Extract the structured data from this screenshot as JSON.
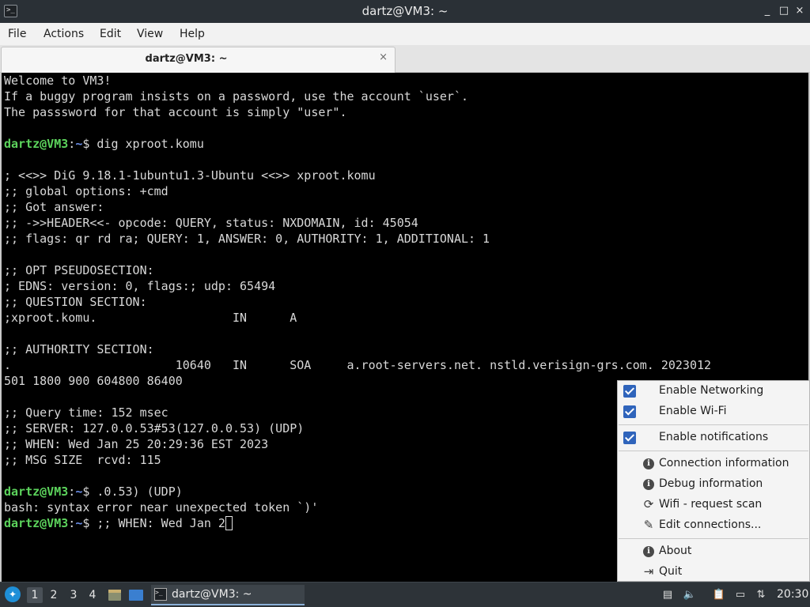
{
  "window": {
    "title": "dartz@VM3: ~",
    "app_icon": "terminal-icon",
    "controls": {
      "minimize": "_",
      "maximize": "□",
      "close": "×"
    }
  },
  "menubar": {
    "items": [
      "File",
      "Actions",
      "Edit",
      "View",
      "Help"
    ]
  },
  "tabs": [
    {
      "label": "dartz@VM3: ~",
      "close": "×"
    }
  ],
  "terminal": {
    "prompt_user": "dartz@VM3",
    "prompt_sep": ":",
    "prompt_path": "~",
    "prompt_dollar": "$",
    "lines": [
      "Welcome to VM3!",
      "If a buggy program insists on a password, use the account `user`.",
      "The passsword for that account is simply \"user\".",
      "",
      " dig xproot.komu",
      "",
      "; <<>> DiG 9.18.1-1ubuntu1.3-Ubuntu <<>> xproot.komu",
      ";; global options: +cmd",
      ";; Got answer:",
      ";; ->>HEADER<<- opcode: QUERY, status: NXDOMAIN, id: 45054",
      ";; flags: qr rd ra; QUERY: 1, ANSWER: 0, AUTHORITY: 1, ADDITIONAL: 1",
      "",
      ";; OPT PSEUDOSECTION:",
      "; EDNS: version: 0, flags:; udp: 65494",
      ";; QUESTION SECTION:",
      ";xproot.komu.                   IN      A",
      "",
      ";; AUTHORITY SECTION:",
      ".                       10640   IN      SOA     a.root-servers.net. nstld.verisign-grs.com. 2023012",
      "501 1800 900 604800 86400",
      "",
      ";; Query time: 152 msec",
      ";; SERVER: 127.0.0.53#53(127.0.0.53) (UDP)",
      ";; WHEN: Wed Jan 25 20:29:36 EST 2023",
      ";; MSG SIZE  rcvd: 115",
      "",
      " .0.53) (UDP)",
      "bash: syntax error near unexpected token `)'",
      " ;; WHEN: Wed Jan 2"
    ]
  },
  "network_menu": {
    "enable_networking": {
      "label": "Enable Networking",
      "checked": true
    },
    "enable_wifi": {
      "label": "Enable Wi-Fi",
      "checked": true
    },
    "enable_notifications": {
      "label": "Enable notifications",
      "checked": true
    },
    "connection_information": {
      "label": "Connection information",
      "icon": "info-icon"
    },
    "debug_information": {
      "label": "Debug information",
      "icon": "info-icon"
    },
    "wifi_request_scan": {
      "label": "Wifi - request scan",
      "icon": "refresh-icon"
    },
    "edit_connections": {
      "label": "Edit connections...",
      "icon": "pencil-icon"
    },
    "about": {
      "label": "About",
      "icon": "info-icon"
    },
    "quit": {
      "label": "Quit",
      "icon": "exit-icon"
    }
  },
  "taskbar": {
    "workspaces": [
      "1",
      "2",
      "3",
      "4"
    ],
    "active_workspace": "1",
    "task_label": "dartz@VM3: ~",
    "clock": "20:30",
    "accent": "#1e8fd8"
  }
}
